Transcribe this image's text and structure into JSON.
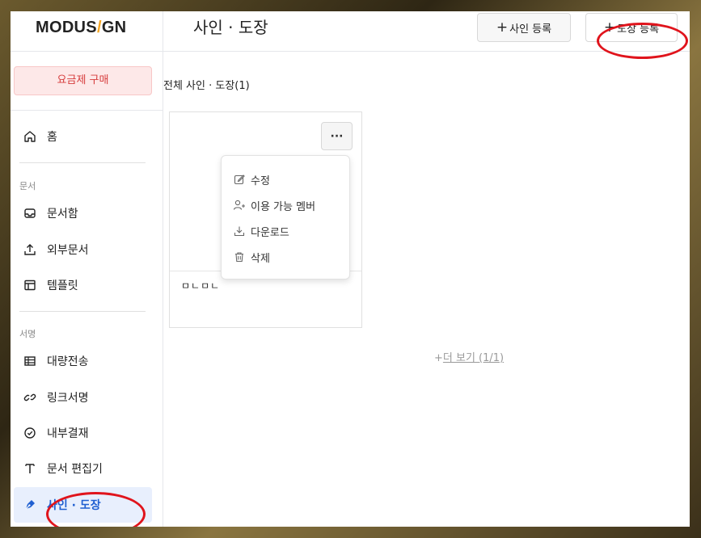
{
  "app": {
    "logo_left": "MODUS",
    "logo_slash": "/",
    "logo_right": "GN"
  },
  "sidebar": {
    "plan_button": "요금제 구매",
    "home": "홈",
    "section_docs": "문서",
    "docs_items": [
      "문서함",
      "외부문서",
      "템플릿"
    ],
    "section_sign": "서명",
    "sign_items": [
      "대량전송",
      "링크서명",
      "내부결재",
      "문서 편집기",
      "사인 · 도장"
    ]
  },
  "header": {
    "title": "사인 · 도장",
    "add_sign": "사인 등록",
    "add_stamp": "도장 등록",
    "plus": "+"
  },
  "main": {
    "all_label": "전체 사인 · 도장(1)",
    "card_name": "ㅁㄴㅁㄴ",
    "more_dots": "···",
    "menu": [
      "수정",
      "이용 가능 멤버",
      "다운로드",
      "삭제"
    ],
    "more_link_prefix": "+",
    "more_link": "더 보기 (1/1)"
  },
  "colors": {
    "accent": "#1f5fd1",
    "plan": "#d63c3c",
    "annotation": "#e0141c"
  }
}
